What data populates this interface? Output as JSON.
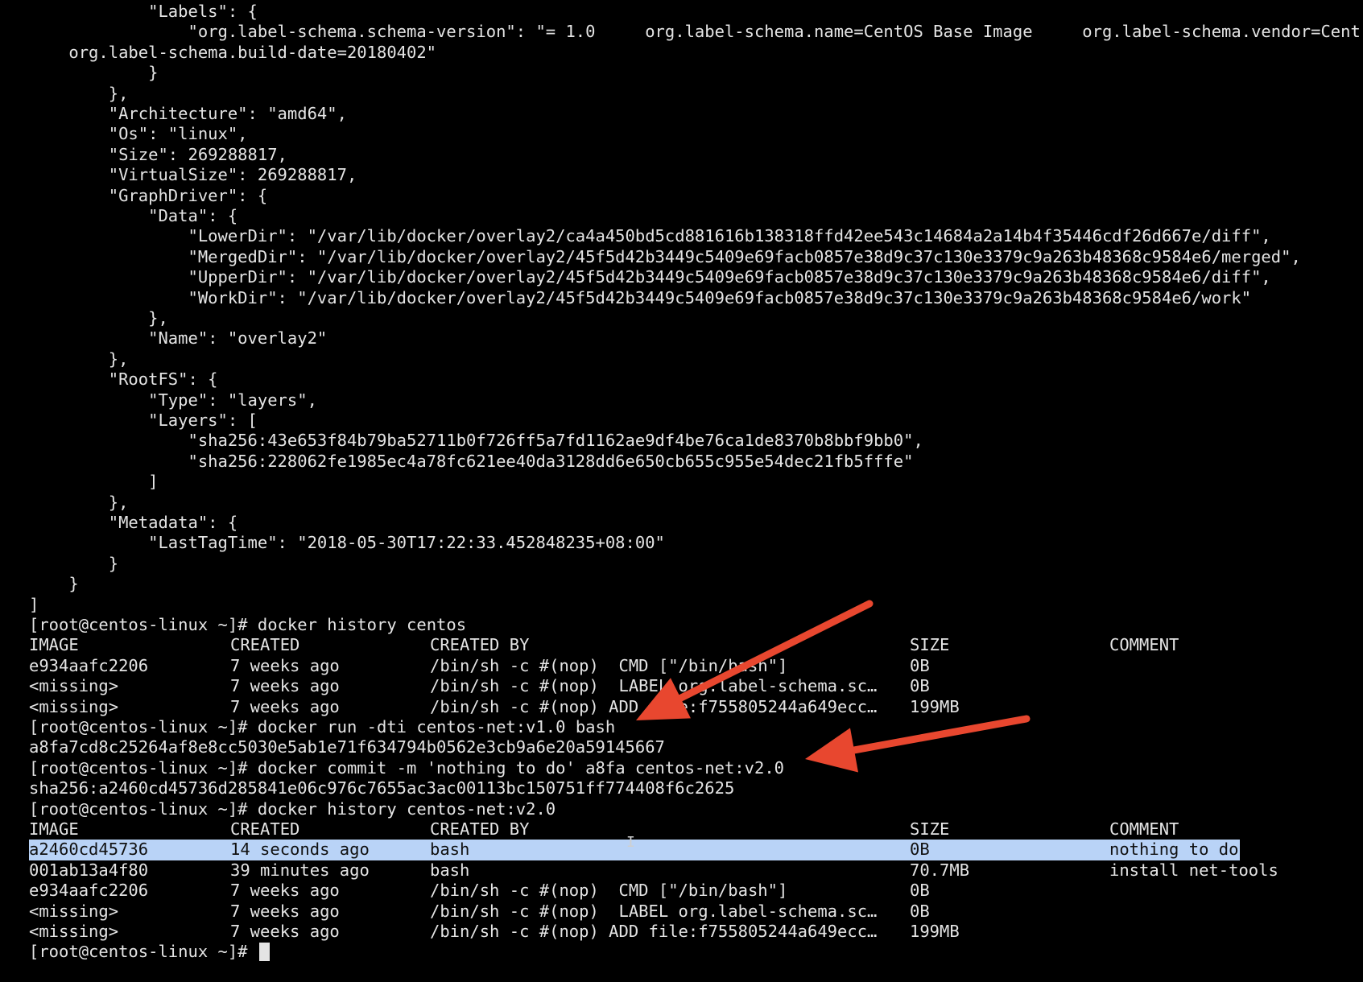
{
  "terminal": {
    "prompt": "[root@centos-linux ~]# ",
    "json_lines": [
      "            \"Labels\": {",
      "                \"org.label-schema.schema-version\": \"= 1.0     org.label-schema.name=CentOS Base Image     org.label-schema.vendor=Cent",
      "    org.label-schema.build-date=20180402\"",
      "            }",
      "        },",
      "        \"Architecture\": \"amd64\",",
      "        \"Os\": \"linux\",",
      "        \"Size\": 269288817,",
      "        \"VirtualSize\": 269288817,",
      "        \"GraphDriver\": {",
      "            \"Data\": {",
      "                \"LowerDir\": \"/var/lib/docker/overlay2/ca4a450bd5cd881616b138318ffd42ee543c14684a2a14b4f35446cdf26d667e/diff\",",
      "                \"MergedDir\": \"/var/lib/docker/overlay2/45f5d42b3449c5409e69facb0857e38d9c37c130e3379c9a263b48368c9584e6/merged\",",
      "                \"UpperDir\": \"/var/lib/docker/overlay2/45f5d42b3449c5409e69facb0857e38d9c37c130e3379c9a263b48368c9584e6/diff\",",
      "                \"WorkDir\": \"/var/lib/docker/overlay2/45f5d42b3449c5409e69facb0857e38d9c37c130e3379c9a263b48368c9584e6/work\"",
      "            },",
      "            \"Name\": \"overlay2\"",
      "        },",
      "        \"RootFS\": {",
      "            \"Type\": \"layers\",",
      "            \"Layers\": [",
      "                \"sha256:43e653f84b79ba52711b0f726ff5a7fd1162ae9df4be76ca1de8370b8bbf9bb0\",",
      "                \"sha256:228062fe1985ec4a78fc621ee40da3128dd6e650cb655c955e54dec21fb5fffe\"",
      "            ]",
      "        },",
      "        \"Metadata\": {",
      "            \"LastTagTime\": \"2018-05-30T17:22:33.452848235+08:00\"",
      "        }",
      "    }",
      "]"
    ],
    "commands": {
      "history_centos": "docker history centos",
      "run": "docker run -dti centos-net:v1.0 bash",
      "commit": "docker commit -m 'nothing to do' a8fa centos-net:v2.0",
      "history_v2": "docker history centos-net:v2.0"
    },
    "outputs": {
      "run_container_id": "a8fa7cd8c25264af8e8cc5030e5ab1e71f634794b0562e3cb9a6e20a59145667",
      "commit_digest": "sha256:a2460cd45736d285841e06c976c7655ac3ac00113bc150751ff774408f6c2625"
    },
    "history_headers": [
      "IMAGE",
      "CREATED",
      "CREATED BY",
      "SIZE",
      "COMMENT"
    ],
    "history_centos_rows": [
      [
        "e934aafc2206",
        "7 weeks ago",
        "/bin/sh -c #(nop)  CMD [\"/bin/bash\"]",
        "0B",
        ""
      ],
      [
        "<missing>",
        "7 weeks ago",
        "/bin/sh -c #(nop)  LABEL org.label-schema.sc…",
        "0B",
        ""
      ],
      [
        "<missing>",
        "7 weeks ago",
        "/bin/sh -c #(nop) ADD file:f755805244a649ecc…",
        "199MB",
        ""
      ]
    ],
    "history_v2_rows": [
      [
        "a2460cd45736",
        "14 seconds ago",
        "bash",
        "0B",
        "nothing to do"
      ],
      [
        "001ab13a4f80",
        "39 minutes ago",
        "bash",
        "70.7MB",
        "install net-tools"
      ],
      [
        "e934aafc2206",
        "7 weeks ago",
        "/bin/sh -c #(nop)  CMD [\"/bin/bash\"]",
        "0B",
        ""
      ],
      [
        "<missing>",
        "7 weeks ago",
        "/bin/sh -c #(nop)  LABEL org.label-schema.sc…",
        "0B",
        ""
      ],
      [
        "<missing>",
        "7 weeks ago",
        "/bin/sh -c #(nop) ADD file:f755805244a649ecc…",
        "199MB",
        ""
      ]
    ],
    "selected_row_index": 0,
    "colors": {
      "background": "#000000",
      "foreground": "#e4e4e4",
      "selection": "#b9d3f7",
      "annotation_arrow": "#e8472f"
    },
    "annotation_arrow_count": 2
  }
}
